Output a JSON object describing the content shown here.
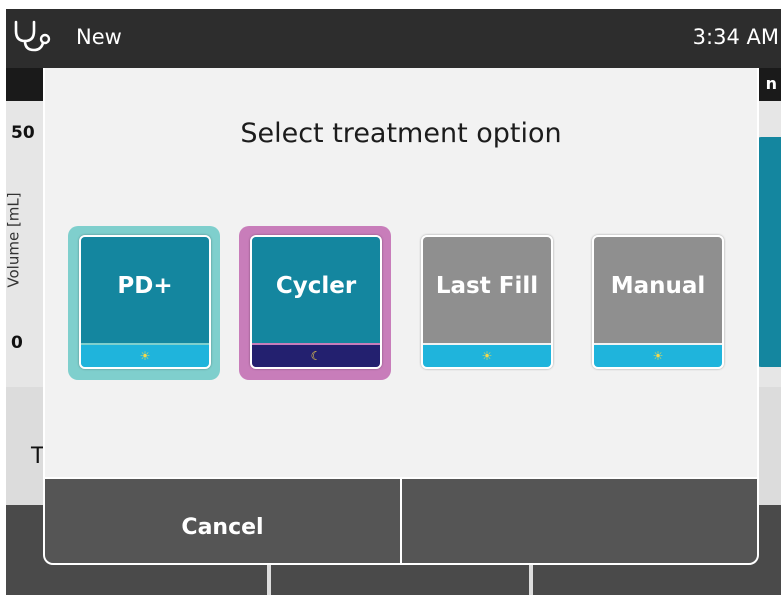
{
  "status_bar": {
    "title": "New",
    "time": "3:34 AM",
    "icon": "stethoscope-icon"
  },
  "background": {
    "header_text": "n",
    "y_max": "50",
    "y_min": "0",
    "y_axis_label": "Volume [mL]",
    "lower_text": "T"
  },
  "dialog": {
    "title": "Select treatment option",
    "options": [
      {
        "label": "PD+",
        "mode_icon": "sun-icon",
        "selected": true,
        "highlight_color": "#7fcfcd",
        "tile_color": "#14869f"
      },
      {
        "label": "Cycler",
        "mode_icon": "moon-icon",
        "selected": true,
        "highlight_color": "#c87dba",
        "tile_color": "#14869f"
      },
      {
        "label": "Last Fill",
        "mode_icon": "sun-icon",
        "selected": false,
        "tile_color": "#8f8f8f"
      },
      {
        "label": "Manual",
        "mode_icon": "sun-icon",
        "selected": false,
        "tile_color": "#8f8f8f"
      }
    ],
    "cancel_label": "Cancel",
    "sun_glyph": "☀",
    "moon_glyph": "☾"
  },
  "colors": {
    "accent": "#14869f",
    "day_strip": "#1fb4dc",
    "night_strip": "#23206f",
    "footer": "#555555"
  }
}
